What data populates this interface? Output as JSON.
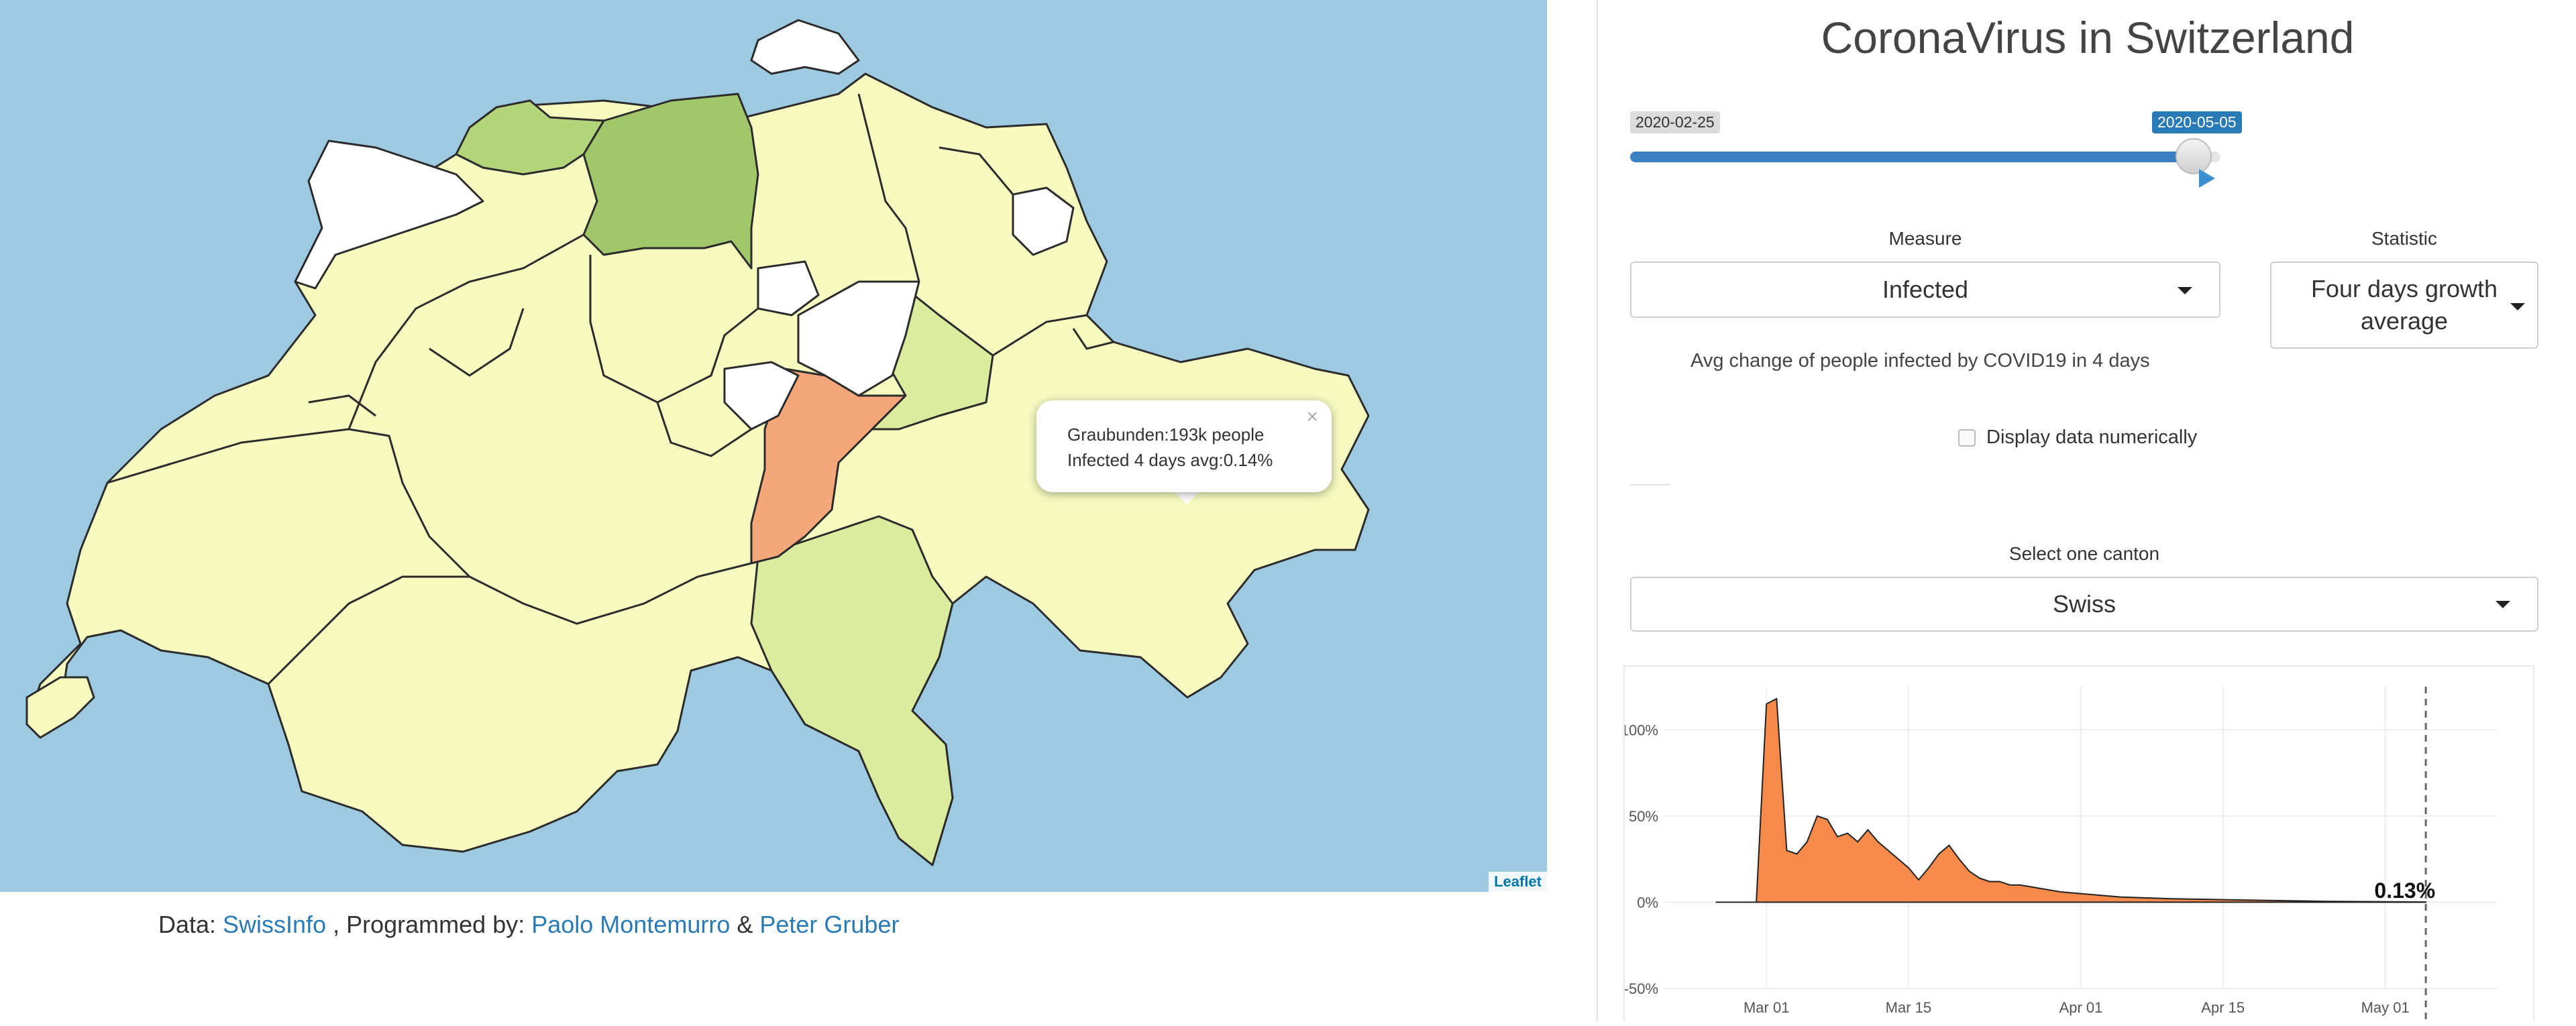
{
  "map": {
    "attribution": "Leaflet",
    "popup": {
      "line1": "Graubunden:193k people",
      "line2": "Infected 4 days avg:0.14%",
      "close": "×"
    },
    "fill_colors": {
      "water": "#9ecae1",
      "pale": "#f7fbc0",
      "light_green": "#dcec9e",
      "green": "#b3d47a",
      "dark_green": "#a2c76a",
      "orange": "#f4a77a",
      "white": "#ffffff"
    }
  },
  "credits": {
    "prefix": "Data: ",
    "source_link": "SwissInfo",
    "middle": " , Programmed by: ",
    "author1": "Paolo Montemurro",
    "amp": " & ",
    "author2": "Peter Gruber"
  },
  "sidebar": {
    "title": "CoronaVirus in Switzerland",
    "slider": {
      "min_label": "2020-02-25",
      "max_label": "2020-05-05",
      "fill_fraction": 0.98
    },
    "measure": {
      "label": "Measure",
      "value": "Infected"
    },
    "statistic": {
      "label": "Statistic",
      "value": "Four days growth average"
    },
    "help_text": "Avg change of people infected by COVID19 in 4 days",
    "checkbox_label": "Display data numerically",
    "canton": {
      "label": "Select one canton",
      "value": "Swiss"
    },
    "accent_color": "#2a7ab5"
  },
  "chart_data": {
    "type": "area",
    "x_dates": [
      "2020-02-25",
      "2020-02-26",
      "2020-02-27",
      "2020-02-28",
      "2020-02-29",
      "2020-03-01",
      "2020-03-02",
      "2020-03-03",
      "2020-03-04",
      "2020-03-05",
      "2020-03-06",
      "2020-03-07",
      "2020-03-08",
      "2020-03-09",
      "2020-03-10",
      "2020-03-11",
      "2020-03-12",
      "2020-03-13",
      "2020-03-14",
      "2020-03-15",
      "2020-03-16",
      "2020-03-17",
      "2020-03-18",
      "2020-03-19",
      "2020-03-20",
      "2020-03-21",
      "2020-03-22",
      "2020-03-23",
      "2020-03-24",
      "2020-03-25",
      "2020-03-26",
      "2020-03-27",
      "2020-03-28",
      "2020-03-29",
      "2020-03-30",
      "2020-04-01",
      "2020-04-05",
      "2020-04-10",
      "2020-04-15",
      "2020-04-20",
      "2020-04-25",
      "2020-04-30",
      "2020-05-05"
    ],
    "values": [
      0,
      0,
      0,
      0,
      0,
      115,
      118,
      30,
      28,
      35,
      50,
      48,
      38,
      40,
      35,
      42,
      35,
      30,
      25,
      20,
      13,
      20,
      28,
      33,
      25,
      18,
      14,
      12,
      12,
      10,
      10,
      9,
      8,
      7,
      6,
      5,
      3,
      2,
      1.5,
      1,
      0.5,
      0.3,
      0.13
    ],
    "ylim": [
      -50,
      125
    ],
    "yticks": [
      "100%",
      "50%",
      "0%",
      "-50%"
    ],
    "ytick_values": [
      100,
      50,
      0,
      -50
    ],
    "xticks": [
      "Mar 01",
      "Mar 15",
      "Apr 01",
      "Apr 15",
      "May 01"
    ],
    "xtick_dates": [
      "2020-03-01",
      "2020-03-15",
      "2020-04-01",
      "2020-04-15",
      "2020-05-01"
    ],
    "end_label": "0.13%",
    "reference_line_date": "2020-05-05",
    "fill_color": "#f58a4b",
    "grid": true
  }
}
